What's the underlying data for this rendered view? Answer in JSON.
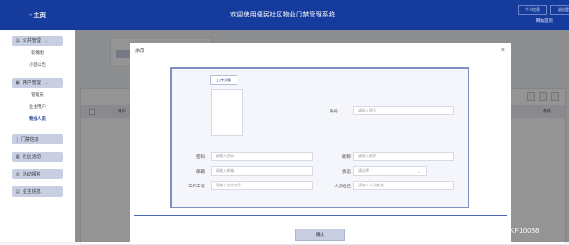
{
  "sidebar": {
    "brand": "主页",
    "groups": [
      {
        "label": "公共管理",
        "items": [
          "轮播图",
          "小区公告"
        ]
      },
      {
        "label": "用户管理",
        "items": [
          "管理员",
          "业主用户",
          "物业人员"
        ]
      }
    ],
    "active_item": "物业人员",
    "singles": [
      "门禁信息",
      "社区活动",
      "活动报名",
      "业主信息"
    ]
  },
  "header": {
    "title": "欢迎使用便民社区物业门禁管理系统",
    "btn_user": "个人信息",
    "btn_logout": "退出登录",
    "site_link": "网站首页"
  },
  "background_table": {
    "col_user": "用户",
    "col_action": "操作"
  },
  "modal": {
    "title": "添加",
    "close": "×",
    "upload_label": "上传头像",
    "fields": {
      "account": {
        "label": "账号",
        "placeholder": "请输入账号"
      },
      "password": {
        "label": "密码",
        "placeholder": "请输入密码"
      },
      "nickname": {
        "label": "昵称",
        "placeholder": "请输入昵称"
      },
      "email": {
        "label": "邮箱",
        "placeholder": "请输入邮箱"
      },
      "status": {
        "label": "状态",
        "placeholder": "请选择"
      },
      "work_no": {
        "label": "工作工号",
        "placeholder": "请输入工作工号"
      },
      "name": {
        "label": "人员姓名",
        "placeholder": "请输入人员姓名"
      }
    },
    "confirm": "确认"
  },
  "watermark": "CSDN @vx_LCXKF10088",
  "colors": {
    "primary": "#153b9c",
    "menu_bg": "#c9cfe3",
    "form_border": "#7f8fbf"
  }
}
